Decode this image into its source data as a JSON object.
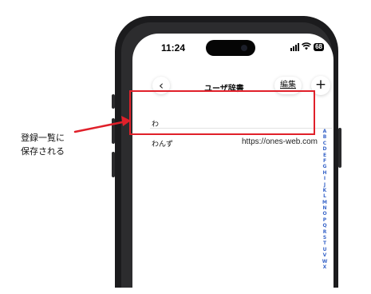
{
  "status_bar": {
    "time": "11:24",
    "battery": "68"
  },
  "nav": {
    "back_icon": "chevron-left-icon",
    "back_glyph": "‹",
    "title": "ユーザ辞書",
    "edit_label": "編集",
    "add_glyph": "+"
  },
  "dictionary": {
    "section_header": "わ",
    "entries": [
      {
        "reading": "わんず",
        "word": "https://ones-web.com"
      }
    ]
  },
  "index_letters": [
    "A",
    "B",
    "C",
    "D",
    "E",
    "F",
    "G",
    "H",
    "I",
    "J",
    "K",
    "L",
    "M",
    "N",
    "O",
    "P",
    "Q",
    "R",
    "S",
    "T",
    "U",
    "V",
    "W",
    "X"
  ],
  "annotation": {
    "caption_line1": "登録一覧に",
    "caption_line2": "保存される",
    "highlight_color": "#e0202a"
  }
}
